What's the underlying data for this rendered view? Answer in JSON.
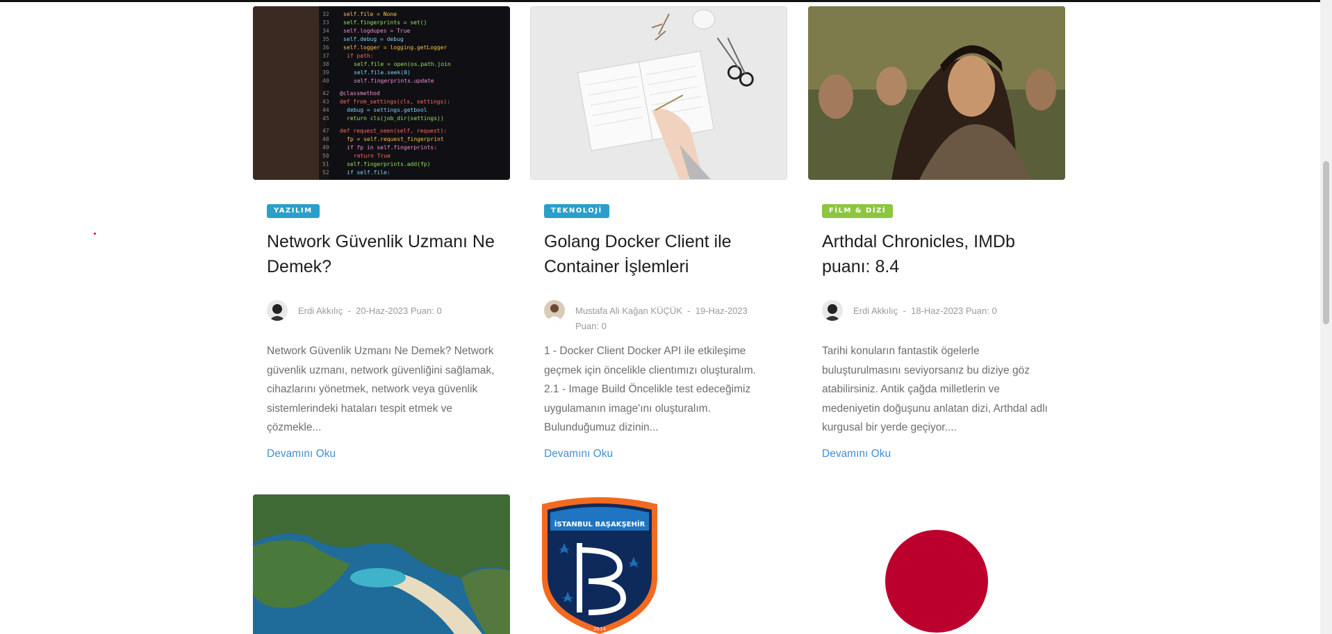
{
  "posts": [
    {
      "category": "YAZILIM",
      "category_color": "#2a9fc9",
      "title": "Network Güvenlik Uzmanı Ne Demek?",
      "author": "Erdi Akkılıç",
      "separator": "-",
      "date": "20-Haz-2023",
      "score": "Puan: 0",
      "excerpt": "Network Güvenlik Uzmanı Ne Demek? Network güvenlik uzmanı, network güvenliğini sağlamak, cihazlarını yönetmek, network veya güvenlik sistemlerindeki hataları tespit etmek ve çözmekle...",
      "read_more": "Devamını Oku",
      "image_icon": "code-screen-image"
    },
    {
      "category": "TEKNOLOJİ",
      "category_color": "#2a9fc9",
      "title": "Golang Docker Client ile Container İşlemleri",
      "author": "Mustafa Ali Kağan KÜÇÜK",
      "separator": "-",
      "date": "19-Haz-2023",
      "score": "Puan: 0",
      "excerpt": "1 - Docker Client Docker API ile etkileşime geçmek için öncelikle clientımızı oluşturalım. 2.1 - Image Build Öncelikle test edeceğimiz uygulamanın image'ını oluşturalım. Bulunduğumuz dizinin...",
      "read_more": "Devamını Oku",
      "image_icon": "notebook-desk-image"
    },
    {
      "category": "FİLM & DİZİ",
      "category_color": "#8cc63f",
      "title": "Arthdal Chronicles, IMDb puanı: 8.4",
      "author": "Erdi Akkılıç",
      "separator": "-",
      "date": "18-Haz-2023",
      "score": "Puan: 0",
      "excerpt": "Tarihi konuların fantastik ögelerle buluşturulmasını seviyorsanız bu diziye göz atabilirsiniz. Antik çağda milletlerin ve medeniyetin doğuşunu anlatan dizi, Arthdal adlı kurgusal bir yerde geçiyor....",
      "read_more": "Devamını Oku",
      "image_icon": "warrior-portrait-image"
    }
  ],
  "bottom_row": {
    "club_logo_text": "İSTANBUL BAŞAKŞEHİR",
    "club_logo_year": "2014",
    "images": [
      "coastline-aerial-image",
      "club-crest-image",
      "japan-flag-image"
    ]
  }
}
